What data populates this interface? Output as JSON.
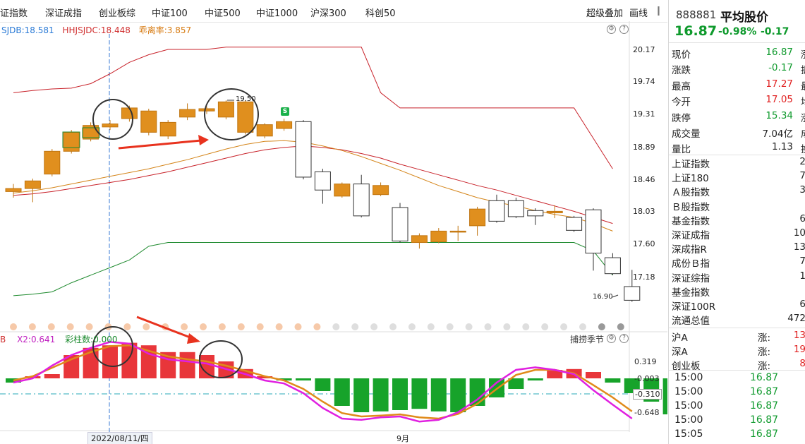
{
  "tabs": [
    "证指数",
    "深证成指",
    "创业板综",
    "中证100",
    "中证500",
    "中证1000",
    "沪深300",
    "科创50"
  ],
  "toolbar": {
    "overlay": "超级叠加",
    "draw": "画线"
  },
  "indicators_top": {
    "a": "SJDB:18.581",
    "b": "HHJSJDC:18.448",
    "c": "乖离率:3.857"
  },
  "indicators_bottom": {
    "a": "B",
    "b": "X2:0.641",
    "c": "彩柱数:0.000"
  },
  "sub_tool": "捕捞季节",
  "price_axis": [
    "20.17",
    "19.74",
    "19.31",
    "18.89",
    "18.46",
    "18.03",
    "17.60",
    "17.18"
  ],
  "macd_axis": [
    "0.319",
    "-0.003",
    "-0.310",
    "-0.648"
  ],
  "annotations": {
    "high": "19.50",
    "low": "16.90",
    "signal": "S"
  },
  "x_axis": {
    "date": "2022/08/11/四",
    "month": "9月"
  },
  "quote": {
    "code": "888881",
    "name": "平均股价",
    "price": "16.87",
    "pct": "-0.98%",
    "chg": "-0.17"
  },
  "stats": [
    {
      "label": "现价",
      "value": "16.87",
      "cut": "涨",
      "color": "#0f9a2d"
    },
    {
      "label": "涨跌",
      "value": "-0.17",
      "cut": "振",
      "color": "#0f9a2d"
    },
    {
      "label": "最高",
      "value": "17.27",
      "cut": "最",
      "color": "#e02020"
    },
    {
      "label": "今开",
      "value": "17.05",
      "cut": "均",
      "color": "#e02020"
    },
    {
      "label": "跌停",
      "value": "15.34",
      "cut": "涨",
      "color": "#0f9a2d"
    },
    {
      "label": "成交量",
      "value": "7.04亿",
      "cut": "成",
      "color": "#222222"
    },
    {
      "label": "量比",
      "value": "1.13",
      "cut": "换",
      "color": "#222222"
    }
  ],
  "index_list": [
    {
      "label": "上证指数",
      "value": "2"
    },
    {
      "label": "上证180",
      "value": "7"
    },
    {
      "label": "Ａ股指数",
      "value": "3"
    },
    {
      "label": "Ｂ股指数",
      "value": ""
    },
    {
      "label": "基金指数",
      "value": "6"
    },
    {
      "label": "深证成指",
      "value": "10"
    },
    {
      "label": "深成指R",
      "value": "13"
    },
    {
      "label": "成份Ｂ指",
      "value": "7"
    },
    {
      "label": "深证综指",
      "value": "1"
    },
    {
      "label": "基金指数",
      "value": ""
    },
    {
      "label": "深证100R",
      "value": "6"
    },
    {
      "label": "流通总值",
      "value": "472"
    }
  ],
  "markets": [
    {
      "label": "沪A",
      "sub": "涨:",
      "value": "13"
    },
    {
      "label": "深A",
      "sub": "涨:",
      "value": "19"
    },
    {
      "label": "创业板",
      "sub": "涨:",
      "value": "8"
    }
  ],
  "ticks": [
    {
      "time": "15:00",
      "price": "16.87"
    },
    {
      "time": "15:00",
      "price": "16.87"
    },
    {
      "time": "15:00",
      "price": "16.87"
    },
    {
      "time": "15:00",
      "price": "16.87"
    },
    {
      "time": "15:05",
      "price": "16.87"
    }
  ],
  "chart_data": {
    "type": "candlestick",
    "candles": [
      {
        "o": 18.3,
        "c": 18.34,
        "h": 18.4,
        "l": 18.22
      },
      {
        "o": 18.34,
        "c": 18.44,
        "h": 18.47,
        "l": 18.16
      },
      {
        "o": 18.53,
        "c": 18.83,
        "h": 18.86,
        "l": 18.5
      },
      {
        "o": 18.83,
        "c": 19.08,
        "h": 19.11,
        "l": 18.8
      },
      {
        "o": 18.99,
        "c": 19.17,
        "h": 19.21,
        "l": 18.96
      },
      {
        "o": 19.15,
        "c": 19.19,
        "h": 19.24,
        "l": 19.11
      },
      {
        "o": 19.26,
        "c": 19.4,
        "h": 19.43,
        "l": 19.22
      },
      {
        "o": 19.08,
        "c": 19.36,
        "h": 19.39,
        "l": 19.04
      },
      {
        "o": 19.03,
        "c": 19.21,
        "h": 19.24,
        "l": 18.99
      },
      {
        "o": 19.28,
        "c": 19.38,
        "h": 19.46,
        "l": 19.24
      },
      {
        "o": 19.36,
        "c": 19.39,
        "h": 19.42,
        "l": 19.32
      },
      {
        "o": 19.28,
        "c": 19.48,
        "h": 19.5,
        "l": 19.25
      },
      {
        "o": 19.08,
        "c": 19.48,
        "h": 19.5,
        "l": 19.05
      },
      {
        "o": 19.03,
        "c": 19.18,
        "h": 19.2,
        "l": 19.0
      },
      {
        "o": 19.13,
        "c": 19.22,
        "h": 19.26,
        "l": 19.1
      },
      {
        "o": 19.22,
        "c": 18.49,
        "h": 19.24,
        "l": 18.46
      },
      {
        "o": 18.56,
        "c": 18.32,
        "h": 18.6,
        "l": 18.14
      },
      {
        "o": 18.24,
        "c": 18.4,
        "h": 18.42,
        "l": 18.22
      },
      {
        "o": 18.4,
        "c": 17.98,
        "h": 18.52,
        "l": 17.96
      },
      {
        "o": 18.26,
        "c": 18.38,
        "h": 18.42,
        "l": 18.24
      },
      {
        "o": 18.09,
        "c": 17.65,
        "h": 18.15,
        "l": 17.63
      },
      {
        "o": 17.63,
        "c": 17.72,
        "h": 17.75,
        "l": 17.55
      },
      {
        "o": 17.64,
        "c": 17.78,
        "h": 17.82,
        "l": 17.62
      },
      {
        "o": 17.77,
        "c": 17.78,
        "h": 17.85,
        "l": 17.65
      },
      {
        "o": 17.85,
        "c": 18.07,
        "h": 18.1,
        "l": 17.72
      },
      {
        "o": 18.18,
        "c": 17.91,
        "h": 18.26,
        "l": 17.89
      },
      {
        "o": 18.18,
        "c": 17.97,
        "h": 18.22,
        "l": 17.95
      },
      {
        "o": 18.05,
        "c": 17.98,
        "h": 18.08,
        "l": 17.86
      },
      {
        "o": 18.02,
        "c": 18.04,
        "h": 18.12,
        "l": 17.95
      },
      {
        "o": 17.96,
        "c": 17.79,
        "h": 17.98,
        "l": 17.77
      },
      {
        "o": 18.06,
        "c": 17.49,
        "h": 18.08,
        "l": 17.26
      },
      {
        "o": 17.43,
        "c": 17.22,
        "h": 17.49,
        "l": 17.2
      },
      {
        "o": 17.05,
        "c": 16.87,
        "h": 17.27,
        "l": 16.85
      }
    ],
    "ma_orange": [
      18.28,
      18.31,
      18.35,
      18.4,
      18.45,
      18.5,
      18.55,
      18.6,
      18.66,
      18.72,
      18.79,
      18.86,
      18.92,
      18.96,
      18.97,
      18.95,
      18.9,
      18.84,
      18.76,
      18.67,
      18.58,
      18.48,
      18.38,
      18.3,
      18.22,
      18.16,
      18.11,
      18.05,
      18.0,
      17.96,
      17.88,
      17.78
    ],
    "ma_red": [
      18.25,
      18.27,
      18.3,
      18.34,
      18.38,
      18.42,
      18.46,
      18.51,
      18.56,
      18.62,
      18.68,
      18.74,
      18.8,
      18.85,
      18.88,
      18.9,
      18.88,
      18.85,
      18.8,
      18.74,
      18.66,
      18.59,
      18.52,
      18.45,
      18.38,
      18.32,
      18.25,
      18.18,
      18.11,
      18.04,
      17.96,
      17.88
    ],
    "upper_band": [
      19.6,
      19.63,
      19.65,
      19.66,
      19.72,
      19.85,
      20.0,
      20.1,
      20.17,
      20.17,
      20.17,
      20.2,
      20.2,
      20.2,
      20.2,
      20.2,
      20.2,
      20.2,
      20.2,
      19.6,
      19.4,
      19.4,
      19.4,
      19.4,
      19.4,
      19.4,
      19.4,
      19.4,
      19.4,
      19.4,
      19.0,
      18.6
    ],
    "lower_band": [
      16.93,
      16.95,
      16.98,
      17.1,
      17.2,
      17.3,
      17.4,
      17.58,
      17.63,
      17.63,
      17.63,
      17.63,
      17.63,
      17.63,
      17.63,
      17.63,
      17.63,
      17.63,
      17.63,
      17.63,
      17.63,
      17.63,
      17.63,
      17.63,
      17.63,
      17.63,
      17.63,
      17.63,
      17.63,
      17.63,
      17.52,
      17.2
    ],
    "macd_bars": [
      -0.1,
      0.05,
      0.1,
      0.55,
      0.72,
      0.78,
      0.84,
      0.78,
      0.62,
      0.62,
      0.55,
      0.4,
      0.22,
      0.05,
      -0.05,
      -0.05,
      -0.3,
      -0.65,
      -0.8,
      -0.78,
      -0.75,
      -0.72,
      -0.78,
      -0.8,
      -0.65,
      -0.45,
      -0.25,
      -0.05,
      0.2,
      0.22,
      0.15,
      -0.1,
      -0.35,
      -0.55,
      -0.85
    ],
    "macd_line": [
      -0.1,
      0.0,
      0.3,
      0.55,
      0.72,
      0.86,
      0.82,
      0.58,
      0.45,
      0.4,
      0.35,
      0.22,
      0.1,
      -0.05,
      -0.12,
      -0.35,
      -0.7,
      -0.95,
      -0.98,
      -0.92,
      -0.9,
      -1.02,
      -0.98,
      -0.8,
      -0.5,
      -0.1,
      0.2,
      0.26,
      0.2,
      0.1,
      -0.28,
      -0.62,
      -0.95
    ],
    "signal_line": [
      -0.05,
      0.05,
      0.25,
      0.45,
      0.62,
      0.76,
      0.78,
      0.65,
      0.52,
      0.45,
      0.4,
      0.3,
      0.18,
      0.05,
      -0.05,
      -0.25,
      -0.55,
      -0.82,
      -0.9,
      -0.88,
      -0.85,
      -0.92,
      -0.95,
      -0.84,
      -0.6,
      -0.25,
      0.08,
      0.2,
      0.2,
      0.12,
      -0.16,
      -0.45,
      -0.78
    ]
  }
}
